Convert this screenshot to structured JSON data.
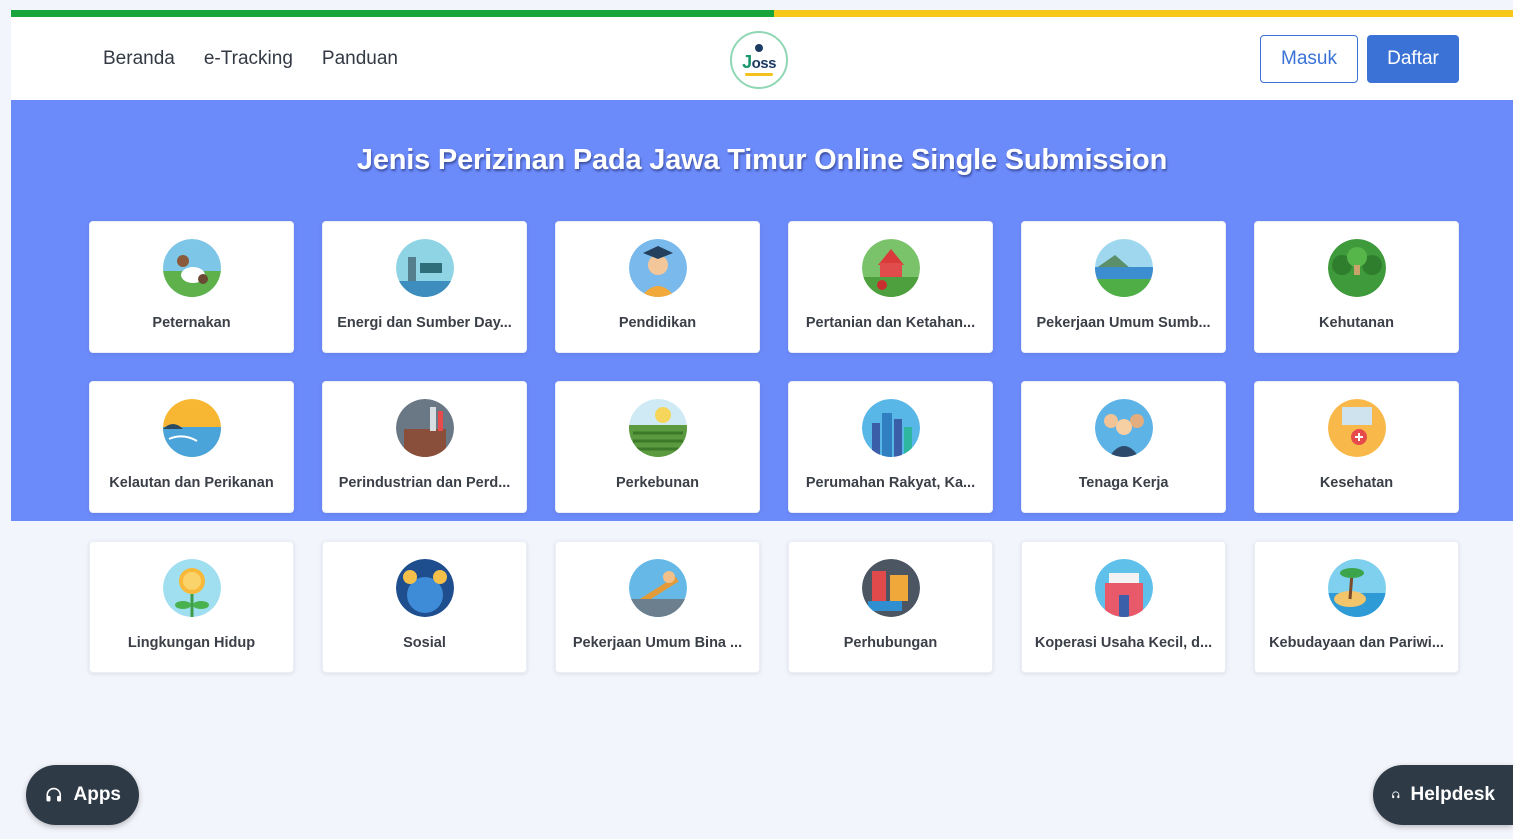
{
  "nav": {
    "links": [
      "Beranda",
      "e-Tracking",
      "Panduan"
    ],
    "logo_text": "oss",
    "logo_letter": "J",
    "masuk_label": "Masuk",
    "daftar_label": "Daftar"
  },
  "colors": {
    "stripe_green": "#17a53c",
    "stripe_yellow": "#f7c81a",
    "hero_bg": "#6c8bfb",
    "primary": "#3b72d6",
    "float_bg": "#2f3a47"
  },
  "hero": {
    "title": "Jenis Perizinan Pada Jawa Timur Online Single Submission"
  },
  "cards": [
    {
      "label": "Peternakan",
      "icon": "livestock-icon"
    },
    {
      "label": "Energi dan Sumber Day...",
      "icon": "energy-icon"
    },
    {
      "label": "Pendidikan",
      "icon": "graduate-icon"
    },
    {
      "label": "Pertanian dan Ketahan...",
      "icon": "farm-icon"
    },
    {
      "label": "Pekerjaan Umum Sumb...",
      "icon": "river-icon"
    },
    {
      "label": "Kehutanan",
      "icon": "forest-icon"
    },
    {
      "label": "Kelautan dan Perikanan",
      "icon": "sea-icon"
    },
    {
      "label": "Perindustrian dan Perd...",
      "icon": "factory-icon"
    },
    {
      "label": "Perkebunan",
      "icon": "plantation-icon"
    },
    {
      "label": "Perumahan Rakyat, Ka...",
      "icon": "city-icon"
    },
    {
      "label": "Tenaga Kerja",
      "icon": "workers-icon"
    },
    {
      "label": "Kesehatan",
      "icon": "health-folder-icon"
    },
    {
      "label": "Lingkungan Hidup",
      "icon": "coin-plant-icon"
    },
    {
      "label": "Sosial",
      "icon": "globe-people-icon"
    },
    {
      "label": "Pekerjaan Umum Bina ...",
      "icon": "construction-icon"
    },
    {
      "label": "Perhubungan",
      "icon": "transport-icon"
    },
    {
      "label": "Koperasi Usaha Kecil, d...",
      "icon": "shop-icon"
    },
    {
      "label": "Kebudayaan dan Pariwi...",
      "icon": "island-icon"
    }
  ],
  "float": {
    "apps_label": "Apps",
    "helpdesk_label": "Helpdesk"
  }
}
